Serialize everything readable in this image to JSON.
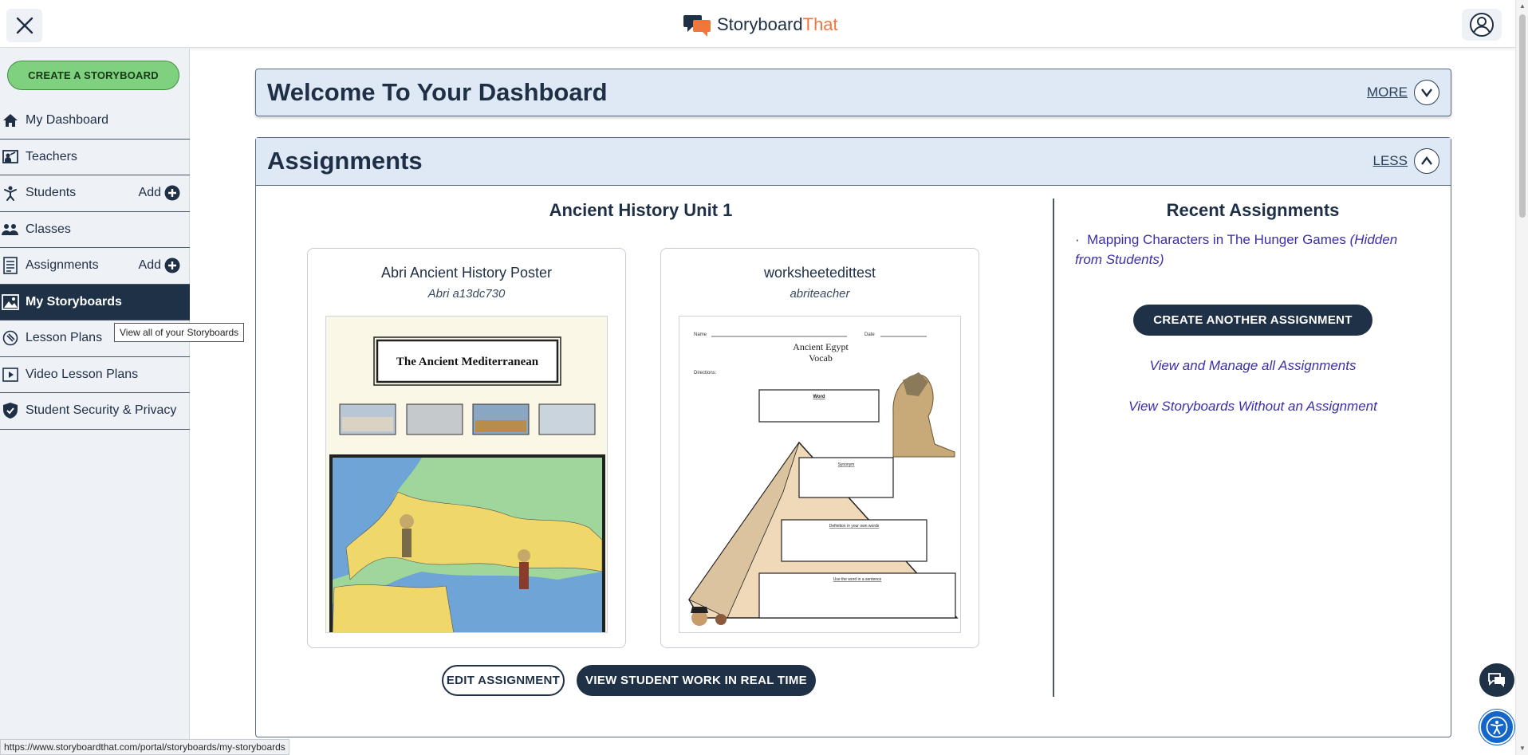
{
  "topbar": {
    "logo_storyboard": "Storyboard",
    "logo_that": "That"
  },
  "sidebar": {
    "create_label": "CREATE A STORYBOARD",
    "items": [
      {
        "label": "My Dashboard",
        "icon": "home-icon"
      },
      {
        "label": "Teachers",
        "icon": "teacher-icon"
      },
      {
        "label": "Students",
        "icon": "students-icon",
        "add": "Add"
      },
      {
        "label": "Classes",
        "icon": "classes-icon"
      },
      {
        "label": "Assignments",
        "icon": "assignments-icon",
        "add": "Add"
      },
      {
        "label": "My Storyboards",
        "icon": "image-icon",
        "active": true
      },
      {
        "label": "Lesson Plans",
        "icon": "lesson-plans-icon"
      },
      {
        "label": "Video Lesson Plans",
        "icon": "video-icon"
      },
      {
        "label": "Student Security & Privacy",
        "icon": "shield-icon"
      }
    ],
    "tooltip": "View all of your Storyboards"
  },
  "welcome": {
    "title": "Welcome To Your Dashboard",
    "toggle": "MORE"
  },
  "assignments": {
    "title": "Assignments",
    "toggle": "LESS",
    "unit_title": "Ancient History Unit 1",
    "cards": [
      {
        "title": "Abri Ancient History Poster",
        "author": "Abri a13dc730",
        "thumb_heading": "The Ancient Mediterranean"
      },
      {
        "title": "worksheetedittest",
        "author": "abriteacher",
        "thumb_heading": "Ancient Egypt",
        "thumb_sub": "Vocab",
        "thumb_name": "Name",
        "thumb_date": "Date",
        "thumb_directions": "Directions:",
        "thumb_word": "Word",
        "thumb_synonym": "Synonym",
        "thumb_definition": "Definition in your own words",
        "thumb_sentence": "Use the word in a sentence"
      }
    ],
    "edit_label": "EDIT ASSIGNMENT",
    "view_label": "VIEW STUDENT WORK IN REAL TIME",
    "recent": {
      "title": "Recent Assignments",
      "items": [
        {
          "bullet": "·",
          "name": "Mapping Characters in The Hunger Games",
          "note": "(Hidden from Students)"
        }
      ],
      "create_label": "CREATE ANOTHER ASSIGNMENT",
      "manage_link": "View and Manage all Assignments",
      "without_link": "View Storyboards Without an Assignment"
    }
  },
  "status_url": "https://www.storyboardthat.com/portal/storyboards/my-storyboards"
}
